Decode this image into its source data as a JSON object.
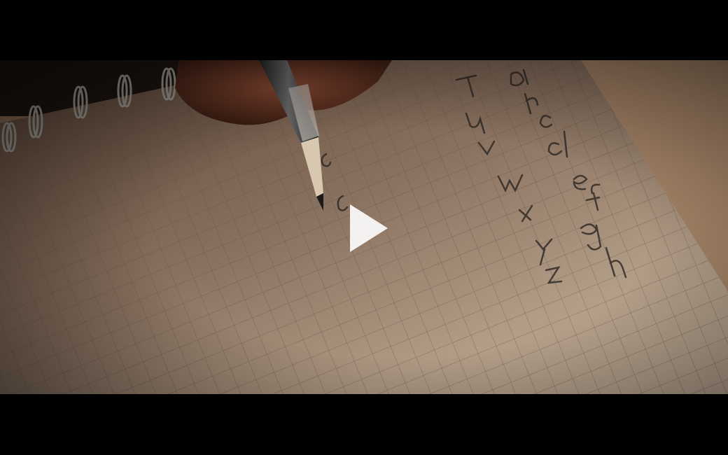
{
  "player": {
    "state": "paused",
    "play_icon": "play-icon",
    "colors": {
      "letterbox": "#000000",
      "play_icon": "#ffffff"
    }
  }
}
